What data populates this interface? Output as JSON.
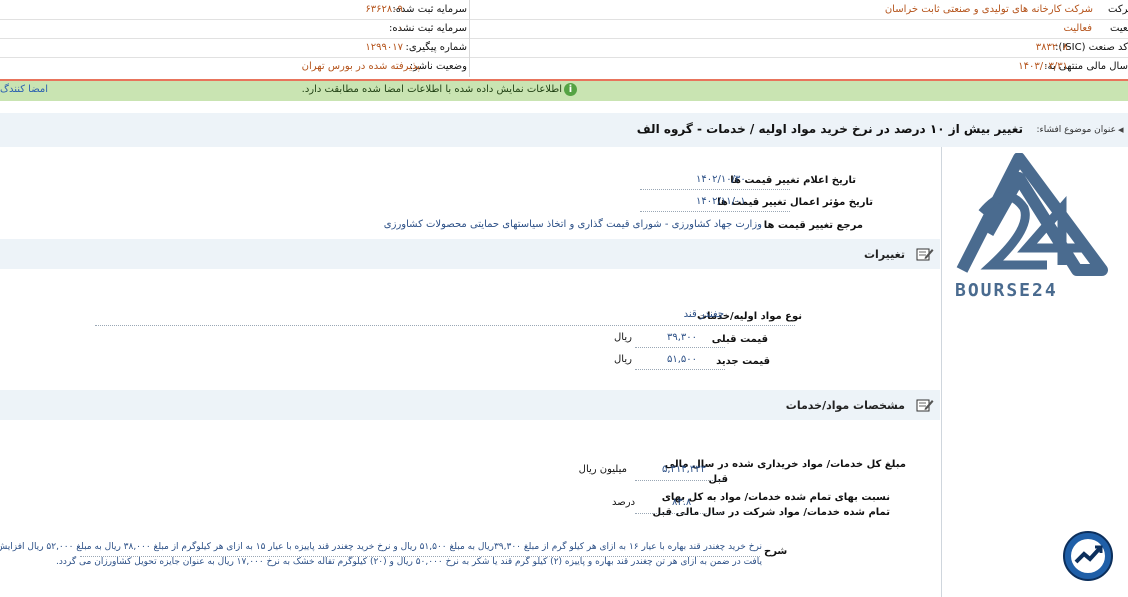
{
  "header": {
    "company_label": "نام شرکت:",
    "company_value": "شرکت کارخانه های تولیدی و صنعتی ثابت خراسان",
    "status_label": "وضعیت:",
    "status_value": "فعالیت",
    "isic_label": "کد صنعت (ISIC):",
    "isic_value": "۳۸۳۲۰۸",
    "fiscal_label": "سال مالی منتهی به:",
    "fiscal_value": "۱۴۰۳/۰۳/۳۱",
    "capital_reg_label": "سرمایه ثبت شده:",
    "capital_reg_value": "۶۳۶۲۸۰۹",
    "capital_unreg_label": "سرمایه ثبت نشده:",
    "capital_unreg_value": "۰",
    "tracking_label": "شماره پیگیری:",
    "tracking_value": "۱۲۹۹۰۱۷",
    "publisher_label": "وضعیت ناشر:",
    "publisher_value": "پذیرفته شده در بورس تهران"
  },
  "notice": {
    "text": "اطلاعات نمایش داده شده با اطلاعات امضا شده مطابقت دارد.",
    "signers_link": "امضا کنندگ"
  },
  "topic": {
    "label": "عنوان موضوع افشاء:",
    "value": "تغییر بیش از ۱۰ درصد در نرخ خرید مواد اولیه / خدمات - گروه الف"
  },
  "dates": {
    "announce_label": "تاریخ اعلام تغییر قیمت ها",
    "announce_value": "۱۴۰۲/۱۰/۳۰",
    "effective_label": "تاریخ مؤثر اعمال تغییر قیمت ها",
    "effective_value": "۱۴۰۲/۱۱/۰۱",
    "authority_label": "مرجع تغییر قیمت ها",
    "authority_value": "وزارت جهاد کشاورزی - شورای قیمت گذاری و اتخاذ سیاستهای حمایتی محصولات کشاورزی"
  },
  "changes": {
    "title": "تغییرات",
    "material_label": "نوع مواد اولیه/خدمات",
    "material_value": "چغندر قند",
    "old_price_label": "قیمت قبلی",
    "old_price_value": "۳۹,۳۰۰",
    "old_price_unit": "ریال",
    "new_price_label": "قیمت جدید",
    "new_price_value": "۵۱,۵۰۰",
    "new_price_unit": "ریال"
  },
  "specs": {
    "title": "مشخصات مواد/خدمات",
    "total_label_1": "مبلغ کل خدمات/ مواد خریداری شده در سال مالی",
    "total_label_2": "قبل",
    "total_value": "۵,۳۱۴,۳۳۳",
    "total_unit": "میلیون ریال",
    "ratio_label_1": "نسبت بهای تمام شده خدمات/ مواد به کل بهای",
    "ratio_label_2": "تمام شده خدمات/ مواد شرکت در سال مالی قبل",
    "ratio_value": "۸۳.۸",
    "ratio_unit": "درصد"
  },
  "description": {
    "label": "شرح",
    "line1": "نرخ خرید چغندر قند بهاره با عیار ۱۶ به ازای هر کیلو گرم از مبلغ ۳۹,۳۰۰ریال به مبلغ ۵۱,۵۰۰ ریال و نرخ خرید چغندر قند پاییزه با عیار ۱۵ به ازای هر کیلوگرم از مبلغ ۳۸,۰۰۰ ریال به مبلغ ۵۲,۰۰۰ ریال افزایش",
    "line2": "یافت در ضمن به ازای هر تن چغندر قند بهاره و پاییزه (۲) کیلو گرم قند یا شکر به نرخ ۵۰,۰۰۰ ریال و (۲۰) کیلوگرم تفاله خشک به نرخ ۱۷,۰۰۰ ریال به عنوان جایزه تحویل کشاورزان می گردد."
  },
  "logo": {
    "brand_text": "BOURSE24",
    "brand_color": "#4a6b8f"
  },
  "icons": [
    "info-icon",
    "edit-icon",
    "logo-24",
    "trend-badge-icon"
  ]
}
